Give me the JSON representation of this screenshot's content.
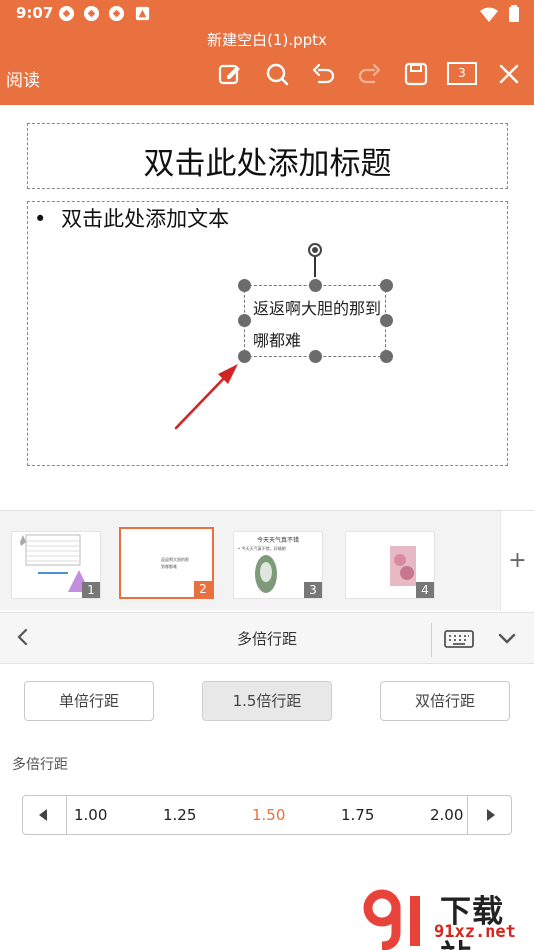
{
  "status_bar": {
    "time": "9:07"
  },
  "app_bar": {
    "file_name": "新建空白(1).pptx",
    "mode_label": "阅读",
    "slide_count_badge": "3"
  },
  "slide": {
    "title_placeholder": "双击此处添加标题",
    "bullet": "•",
    "body_placeholder": "双击此处添加文本",
    "selected_text_box": "返返啊大胆的那到哪都难"
  },
  "thumbnails": [
    {
      "number": "1"
    },
    {
      "number": "2",
      "text": "返返啊大胆的那到哪都难"
    },
    {
      "number": "3",
      "title": "今天天气真不错",
      "bullet": "• 今天天气真不错，好晴朗"
    },
    {
      "number": "4"
    }
  ],
  "add_slide_symbol": "+",
  "spacing_panel": {
    "title": "多倍行距",
    "options": [
      "单倍行距",
      "1.5倍行距",
      "双倍行距"
    ],
    "selected_option": "1.5倍行距",
    "section_label": "多倍行距",
    "values": [
      "1.00",
      "1.25",
      "1.50",
      "1.75",
      "2.00"
    ],
    "selected_value": "1.50"
  },
  "watermark": {
    "text": "下载站",
    "url": "91xz.net"
  },
  "colors": {
    "accent": "#e9703f",
    "arrow": "#d32424"
  }
}
